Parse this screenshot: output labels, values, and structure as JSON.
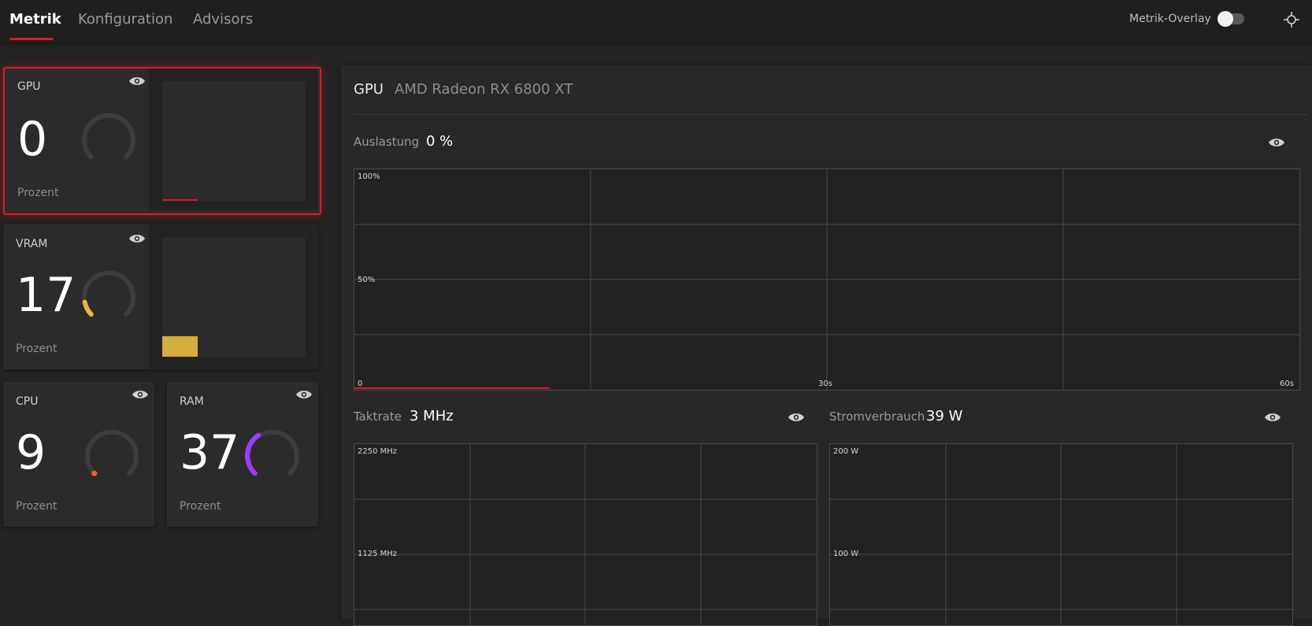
{
  "tabs": [
    {
      "label": "Metrik",
      "active": true
    },
    {
      "label": "Konfiguration",
      "active": false
    },
    {
      "label": "Advisors",
      "active": false
    }
  ],
  "overlay": {
    "label": "Metrik-Overlay",
    "enabled": false
  },
  "icons": {
    "eye": "eye-icon",
    "crosshair": "crosshair-icon"
  },
  "colors": {
    "accent": "#e0162b",
    "vram": "#e1b840",
    "cpu": "#ff5a36",
    "ram": "#9b3cff"
  },
  "cards": {
    "gpu": {
      "title": "GPU",
      "value": "0",
      "unit": "Prozent",
      "percent": 0
    },
    "vram": {
      "title": "VRAM",
      "value": "17",
      "unit": "Prozent",
      "percent": 17
    },
    "cpu": {
      "title": "CPU",
      "value": "9",
      "unit": "Prozent",
      "percent": 9
    },
    "ram": {
      "title": "RAM",
      "value": "37",
      "unit": "Prozent",
      "percent": 37
    }
  },
  "detail": {
    "title": "GPU",
    "device": "AMD Radeon RX 6800 XT",
    "utilization": {
      "label": "Auslastung",
      "value": "0 %",
      "y_labels": {
        "top": "100%",
        "mid": "50%"
      },
      "x_labels": {
        "start": "0",
        "mid": "30s",
        "end": "60s"
      }
    },
    "clock": {
      "label": "Taktrate",
      "value": "3 MHz",
      "y_labels": {
        "top": "2250 MHz",
        "mid": "1125 MHz"
      }
    },
    "power": {
      "label": "Stromverbrauch",
      "value": "39 W",
      "y_labels": {
        "top": "200 W",
        "mid": "100 W"
      }
    }
  }
}
